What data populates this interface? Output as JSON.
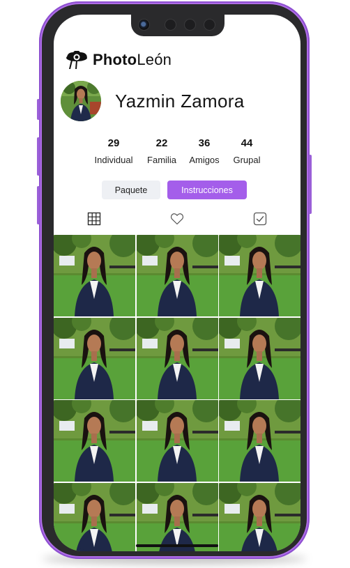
{
  "app": {
    "brand_bold": "Photo",
    "brand_rest": "León"
  },
  "profile": {
    "name": "Yazmin Zamora"
  },
  "stats": [
    {
      "value": "29",
      "label": "Individual"
    },
    {
      "value": "22",
      "label": "Familia"
    },
    {
      "value": "36",
      "label": "Amigos"
    },
    {
      "value": "44",
      "label": "Grupal"
    }
  ],
  "actions": {
    "paquete_label": "Paquete",
    "instrucciones_label": "Instrucciones"
  },
  "tabs": [
    "grid-icon",
    "heart-icon",
    "checkbox-icon"
  ],
  "colors": {
    "accent": "#a45eea",
    "phone_frame": "#b06ee8",
    "secondary_button": "#eef0f4"
  },
  "gallery": {
    "photo_count": 12,
    "columns": 3
  }
}
